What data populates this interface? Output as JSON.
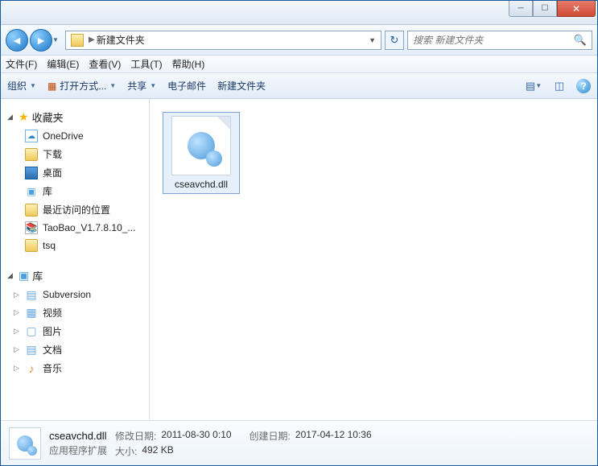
{
  "address": {
    "path": "新建文件夹"
  },
  "search": {
    "placeholder": "搜索 新建文件夹"
  },
  "menubar": {
    "file": "文件(F)",
    "edit": "编辑(E)",
    "view": "查看(V)",
    "tools": "工具(T)",
    "help": "帮助(H)"
  },
  "toolbar": {
    "organize": "组织",
    "open_with": "打开方式...",
    "share": "共享",
    "email": "电子邮件",
    "new_folder": "新建文件夹"
  },
  "sidebar": {
    "favorites": {
      "label": "收藏夹",
      "items": [
        {
          "label": "OneDrive",
          "icon": "onedrive"
        },
        {
          "label": "下载",
          "icon": "folder"
        },
        {
          "label": "桌面",
          "icon": "desktop"
        },
        {
          "label": "库",
          "icon": "libs"
        },
        {
          "label": "最近访问的位置",
          "icon": "recent"
        },
        {
          "label": "TaoBao_V1.7.8.10_...",
          "icon": "archive"
        },
        {
          "label": "tsq",
          "icon": "folder"
        }
      ]
    },
    "libraries": {
      "label": "库",
      "items": [
        {
          "label": "Subversion",
          "expandable": true
        },
        {
          "label": "视频",
          "expandable": true
        },
        {
          "label": "图片",
          "expandable": true
        },
        {
          "label": "文档",
          "expandable": true
        },
        {
          "label": "音乐",
          "expandable": true
        }
      ]
    }
  },
  "content": {
    "selected_file": "cseavchd.dll"
  },
  "details": {
    "name": "cseavchd.dll",
    "type": "应用程序扩展",
    "modified_label": "修改日期:",
    "modified": "2011-08-30 0:10",
    "size_label": "大小:",
    "size": "492 KB",
    "created_label": "创建日期:",
    "created": "2017-04-12 10:36"
  }
}
